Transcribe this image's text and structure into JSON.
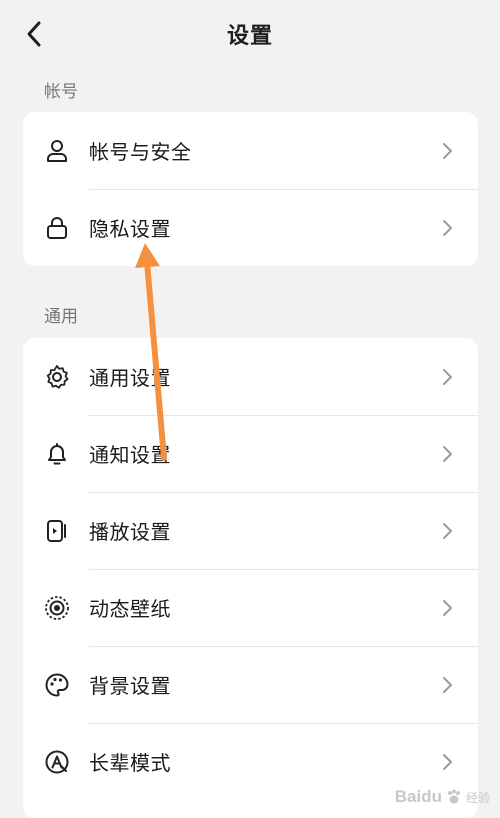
{
  "header": {
    "title": "设置"
  },
  "sections": [
    {
      "label": "帐号",
      "items": [
        {
          "label": "帐号与安全",
          "icon": "user-icon"
        },
        {
          "label": "隐私设置",
          "icon": "lock-icon"
        }
      ]
    },
    {
      "label": "通用",
      "items": [
        {
          "label": "通用设置",
          "icon": "gear-icon"
        },
        {
          "label": "通知设置",
          "icon": "bell-icon"
        },
        {
          "label": "播放设置",
          "icon": "play-device-icon"
        },
        {
          "label": "动态壁纸",
          "icon": "live-wallpaper-icon"
        },
        {
          "label": "背景设置",
          "icon": "palette-icon"
        },
        {
          "label": "长辈模式",
          "icon": "elder-mode-icon"
        }
      ]
    }
  ],
  "annotation": {
    "color": "#f5913e"
  },
  "watermark": {
    "text": "Baidu",
    "sub": "经验"
  }
}
